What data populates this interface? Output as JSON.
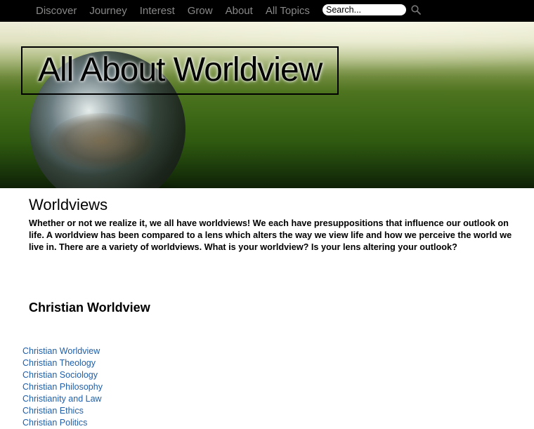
{
  "nav": {
    "items": [
      {
        "label": "Discover"
      },
      {
        "label": "Journey"
      },
      {
        "label": "Interest"
      },
      {
        "label": "Grow"
      },
      {
        "label": "About"
      },
      {
        "label": "All Topics"
      }
    ],
    "search": {
      "placeholder": "Search...",
      "icon": "magnifier-icon"
    }
  },
  "hero": {
    "title": "All About Worldview"
  },
  "main": {
    "title": "Worldviews",
    "intro": "Whether or not we realize it, we all have worldviews! We each have presuppositions that influence our outlook on life. A worldview has been compared to a lens which alters the way we view life and how we perceive the world we live in. There are a variety of worldviews. What is your worldview? Is your lens altering your outlook?",
    "section_heading": "Christian Worldview",
    "links": [
      {
        "label": "Christian Worldview"
      },
      {
        "label": "Christian Theology"
      },
      {
        "label": "Christian Sociology"
      },
      {
        "label": "Christian Philosophy"
      },
      {
        "label": "Christianity and Law"
      },
      {
        "label": "Christian Ethics"
      },
      {
        "label": "Christian Politics"
      }
    ]
  },
  "colors": {
    "nav_bg": "#000000",
    "nav_text": "#888888",
    "link": "#1f5fa9"
  }
}
